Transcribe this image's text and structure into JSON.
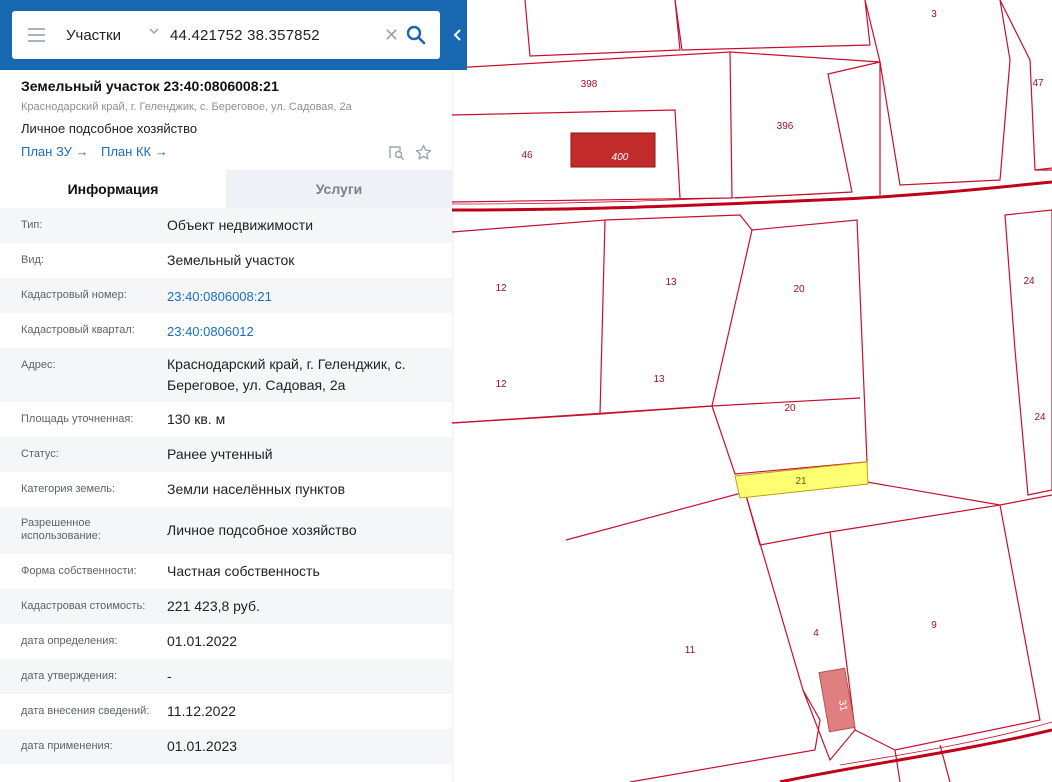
{
  "search": {
    "type_label": "Участки",
    "query": "44.421752 38.357852"
  },
  "object": {
    "title": "Земельный участок 23:40:0806008:21",
    "address": "Краснодарский край, г. Геленджик, с. Береговое, ул. Садовая, 2а",
    "use": "Личное подсобное хозяйство",
    "plan_zu": "План ЗУ →",
    "plan_kk": "План КК →"
  },
  "tabs": {
    "info": "Информация",
    "services": "Услуги"
  },
  "rows": [
    {
      "label": "Тип:",
      "value": "Объект недвижимости"
    },
    {
      "label": "Вид:",
      "value": "Земельный участок"
    },
    {
      "label": "Кадастровый номер:",
      "value": "23:40:0806008:21"
    },
    {
      "label": "Кадастровый квартал:",
      "value": "23:40:0806012"
    },
    {
      "label": "Адрес:",
      "value": "Краснодарский край, г. Геленджик, с. Береговое, ул. Садовая, 2а"
    },
    {
      "label": "Площадь уточненная:",
      "value": "130 кв. м"
    },
    {
      "label": "Статус:",
      "value": "Ранее учтенный"
    },
    {
      "label": "Категория земель:",
      "value": "Земли населённых пунктов"
    },
    {
      "label": "Разрешенное использование:",
      "value": "Личное подсобное хозяйство"
    },
    {
      "label": "Форма собственности:",
      "value": "Частная собственность"
    },
    {
      "label": "Кадастровая стоимость:",
      "value": "221 423,8 руб."
    },
    {
      "label": "дата определения:",
      "value": "01.01.2022"
    },
    {
      "label": "дата утверждения:",
      "value": "-"
    },
    {
      "label": "дата внесения сведений:",
      "value": "11.12.2022"
    },
    {
      "label": "дата применения:",
      "value": "01.01.2023"
    }
  ],
  "map": {
    "parcel_labels": [
      "3",
      "398",
      "47",
      "396",
      "46",
      "400",
      "12",
      "13",
      "20",
      "24",
      "12",
      "13",
      "20",
      "24",
      "21",
      "4",
      "9",
      "11",
      "31"
    ],
    "colors": {
      "boundary": "#c8102e",
      "selected_fill": "#ffff73",
      "building_dark": "#c22b2b",
      "building_light": "#e07f7f",
      "road": "#c00018",
      "tab_blue": "#1768b0",
      "link": "#1a6fc4"
    }
  }
}
